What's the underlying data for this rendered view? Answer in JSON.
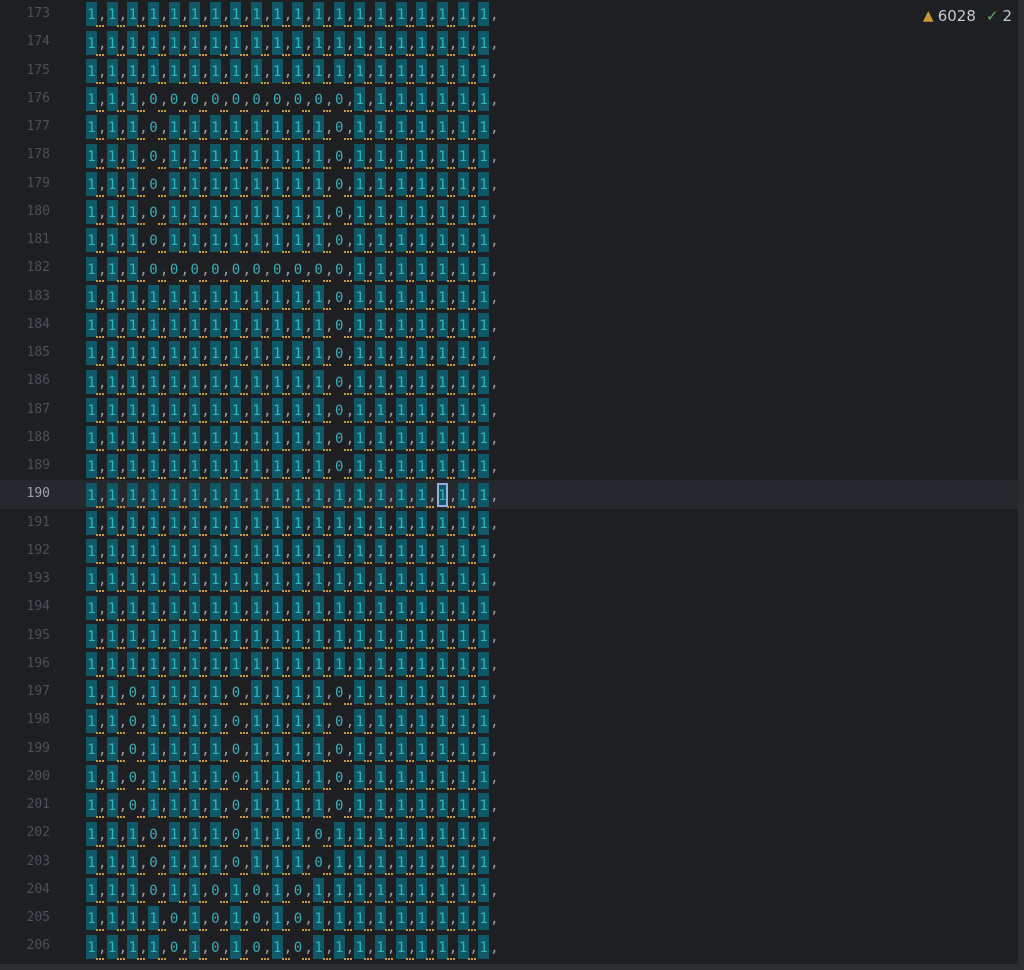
{
  "editor": {
    "first_line_number": 173,
    "current_line_number": 190,
    "caret_column": 17,
    "inspections": {
      "warnings_count": "6028",
      "weak_warnings_count": "2",
      "warning_icon": "warning-triangle-icon",
      "weak_warning_icon": "checkmark-squiggle-icon"
    },
    "lines": [
      "1,1,1,1,1,1,1,1,1,1,1,1,1,1,1,1,1,1,1,1,",
      "1,1,1,1,1,1,1,1,1,1,1,1,1,1,1,1,1,1,1,1,",
      "1,1,1,1,1,1,1,1,1,1,1,1,1,1,1,1,1,1,1,1,",
      "1,1,1,0,0,0,0,0,0,0,0,0,0,1,1,1,1,1,1,1,",
      "1,1,1,0,1,1,1,1,1,1,1,1,0,1,1,1,1,1,1,1,",
      "1,1,1,0,1,1,1,1,1,1,1,1,0,1,1,1,1,1,1,1,",
      "1,1,1,0,1,1,1,1,1,1,1,1,0,1,1,1,1,1,1,1,",
      "1,1,1,0,1,1,1,1,1,1,1,1,0,1,1,1,1,1,1,1,",
      "1,1,1,0,1,1,1,1,1,1,1,1,0,1,1,1,1,1,1,1,",
      "1,1,1,0,0,0,0,0,0,0,0,0,0,1,1,1,1,1,1,1,",
      "1,1,1,1,1,1,1,1,1,1,1,1,0,1,1,1,1,1,1,1,",
      "1,1,1,1,1,1,1,1,1,1,1,1,0,1,1,1,1,1,1,1,",
      "1,1,1,1,1,1,1,1,1,1,1,1,0,1,1,1,1,1,1,1,",
      "1,1,1,1,1,1,1,1,1,1,1,1,0,1,1,1,1,1,1,1,",
      "1,1,1,1,1,1,1,1,1,1,1,1,0,1,1,1,1,1,1,1,",
      "1,1,1,1,1,1,1,1,1,1,1,1,0,1,1,1,1,1,1,1,",
      "1,1,1,1,1,1,1,1,1,1,1,1,0,1,1,1,1,1,1,1,",
      "1,1,1,1,1,1,1,1,1,1,1,1,1,1,1,1,1,1,1,1,",
      "1,1,1,1,1,1,1,1,1,1,1,1,1,1,1,1,1,1,1,1,",
      "1,1,1,1,1,1,1,1,1,1,1,1,1,1,1,1,1,1,1,1,",
      "1,1,1,1,1,1,1,1,1,1,1,1,1,1,1,1,1,1,1,1,",
      "1,1,1,1,1,1,1,1,1,1,1,1,1,1,1,1,1,1,1,1,",
      "1,1,1,1,1,1,1,1,1,1,1,1,1,1,1,1,1,1,1,1,",
      "1,1,1,1,1,1,1,1,1,1,1,1,1,1,1,1,1,1,1,1,",
      "1,1,0,1,1,1,1,0,1,1,1,1,0,1,1,1,1,1,1,1,",
      "1,1,0,1,1,1,1,0,1,1,1,1,0,1,1,1,1,1,1,1,",
      "1,1,0,1,1,1,1,0,1,1,1,1,0,1,1,1,1,1,1,1,",
      "1,1,0,1,1,1,1,0,1,1,1,1,0,1,1,1,1,1,1,1,",
      "1,1,0,1,1,1,1,0,1,1,1,1,0,1,1,1,1,1,1,1,",
      "1,1,1,0,1,1,1,0,1,1,1,0,1,1,1,1,1,1,1,1,",
      "1,1,1,0,1,1,1,0,1,1,1,0,1,1,1,1,1,1,1,1,",
      "1,1,1,0,1,1,0,1,0,1,0,1,1,1,1,1,1,1,1,1,",
      "1,1,1,1,0,1,0,1,0,1,0,1,1,1,1,1,1,1,1,1,",
      "1,1,1,1,0,1,0,1,0,1,0,1,1,1,1,1,1,1,1,1,"
    ]
  }
}
